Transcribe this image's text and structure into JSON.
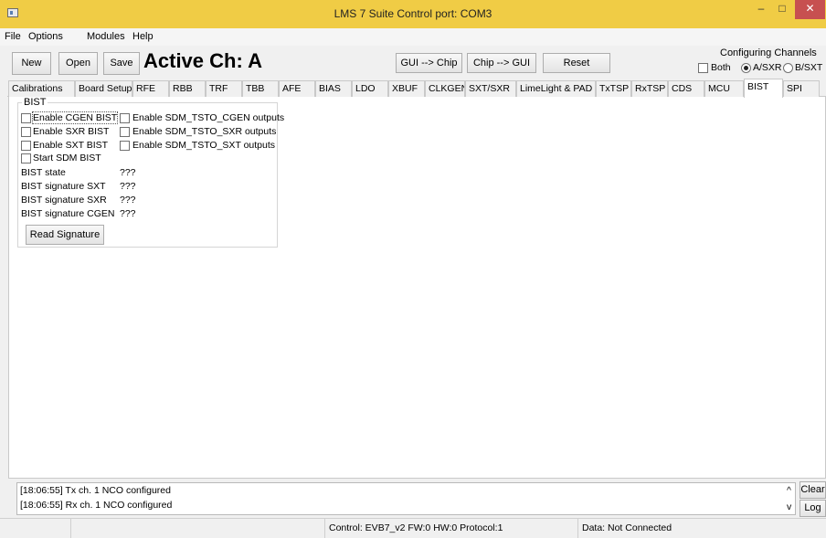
{
  "window": {
    "title": "LMS 7 Suite  Control port: COM3",
    "min_glyph": "–",
    "max_glyph": "□",
    "close_glyph": "✕"
  },
  "menu": [
    "File",
    "Options",
    "Modules",
    "Help"
  ],
  "toolbar": {
    "new_label": "New",
    "open_label": "Open",
    "save_label": "Save",
    "active_channel": "Active Ch: A",
    "gui_to_chip": "GUI --> Chip",
    "chip_to_gui": "Chip --> GUI",
    "reset_label": "Reset",
    "configuring_channels": {
      "legend": "Configuring Channels",
      "both_label": "Both",
      "a_label": "A/SXR",
      "b_label": "B/SXT",
      "both_checked": false,
      "selected": "A/SXR"
    }
  },
  "tabs": [
    "Calibrations",
    "Board Setup",
    "RFE",
    "RBB",
    "TRF",
    "TBB",
    "AFE",
    "BIAS",
    "LDO",
    "XBUF",
    "CLKGEN",
    "SXT/SXR",
    "LimeLight & PAD",
    "TxTSP",
    "RxTSP",
    "CDS",
    "MCU",
    "BIST",
    "SPI"
  ],
  "active_tab": "BIST",
  "bist": {
    "legend": "BIST",
    "checkboxes_left": [
      "Enable CGEN BIST",
      "Enable SXR BIST",
      "Enable SXT BIST",
      "Start SDM BIST"
    ],
    "checkboxes_right": [
      "Enable SDM_TSTO_CGEN outputs",
      "Enable SDM_TSTO_SXR outputs",
      "Enable SDM_TSTO_SXT outputs"
    ],
    "fields": [
      {
        "label": "BIST state",
        "value": "???"
      },
      {
        "label": "BIST signature SXT",
        "value": "???"
      },
      {
        "label": "BIST signature SXR",
        "value": "???"
      },
      {
        "label": "BIST signature CGEN",
        "value": "???"
      }
    ],
    "read_signature_label": "Read Signature"
  },
  "log": {
    "lines": [
      "[18:06:55] Tx ch. 1 NCO configured",
      "[18:06:55] Rx ch. 1 NCO configured"
    ],
    "clear_label": "Clear",
    "log_label": "Log",
    "scroll_up": "^",
    "scroll_down": "v"
  },
  "status": {
    "control": "Control: EVB7_v2  FW:0 HW:0 Protocol:1",
    "data": "Data: Not Connected"
  },
  "colors": {
    "titlebar": "#f0cc45",
    "close_button": "#c75050"
  }
}
